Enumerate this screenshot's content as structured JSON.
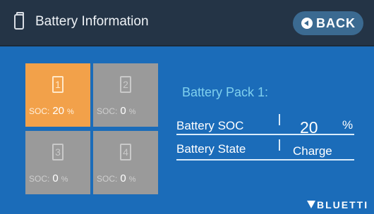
{
  "header": {
    "title": "Battery Information",
    "back_label": "BACK"
  },
  "packs": [
    {
      "number": "1",
      "soc_label": "SOC:",
      "soc_value": "20",
      "unit": "%",
      "active": true
    },
    {
      "number": "2",
      "soc_label": "SOC:",
      "soc_value": "0",
      "unit": "%",
      "active": false
    },
    {
      "number": "3",
      "soc_label": "SOC:",
      "soc_value": "0",
      "unit": "%",
      "active": false
    },
    {
      "number": "4",
      "soc_label": "SOC:",
      "soc_value": "0",
      "unit": "%",
      "active": false
    }
  ],
  "details": {
    "title": "Battery Pack 1:",
    "soc_label": "Battery SOC",
    "soc_value": "20",
    "soc_unit": "%",
    "state_label": "Battery State",
    "state_value": "Charge"
  },
  "brand": "BLUETTI",
  "colors": {
    "header": "#243446",
    "background": "#1b6cb9",
    "active_tile": "#f2a14a",
    "inactive_tile": "#9a9a9a",
    "accent_text": "#7fd0ee"
  },
  "icons": {
    "header": "battery-icon",
    "back": "back-arrow-icon",
    "brand": "bluetti-logo-icon"
  }
}
